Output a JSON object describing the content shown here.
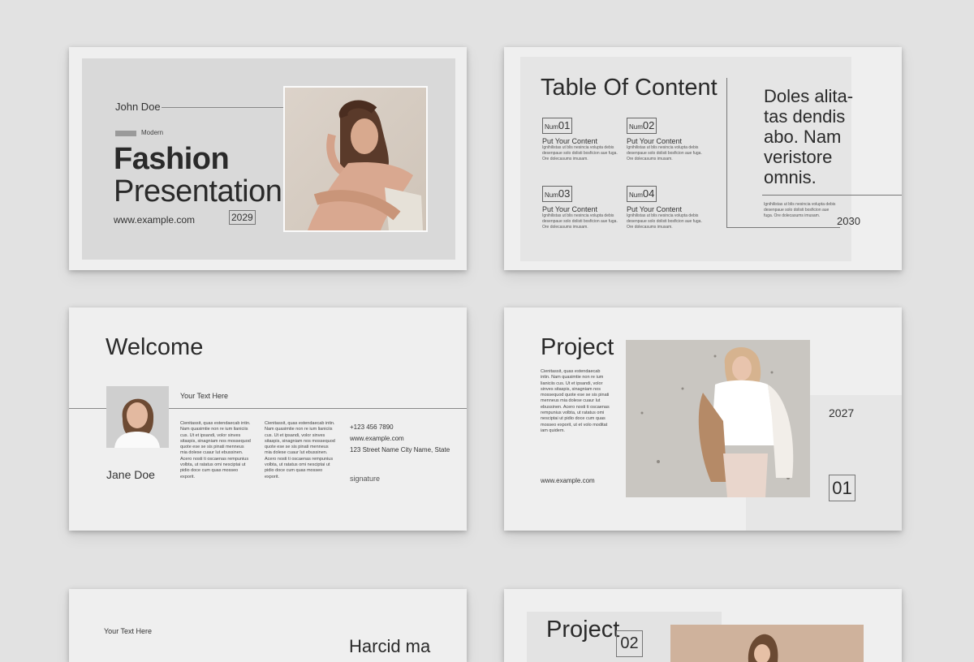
{
  "slide1": {
    "author": "John Doe",
    "tag": "Modern",
    "title_bold": "Fashion",
    "title_light": "Presentation",
    "website": "www.example.com",
    "year": "2029"
  },
  "slide2": {
    "title": "Table Of Content",
    "items": [
      {
        "num_label": "Num",
        "num": "01",
        "title": "Put Your Content",
        "text": "Ignihilistas ut blis nesincia volupta debis desenpaue solo dolisti bosficion aue fuga. Ore dolecasums imusam."
      },
      {
        "num_label": "Num",
        "num": "02",
        "title": "Put Your Content",
        "text": "Ignihilistas ut blis nesincia volupta debis desenpaue solo dolisti bosficion aue fuga. Ore dolecasums imusam."
      },
      {
        "num_label": "Num",
        "num": "03",
        "title": "Put Your Content",
        "text": "Ignihilistas ut blis nesincia volupta debis desenpaue solo dolisti bosficion aue fuga. Ore dolecasums imusam."
      },
      {
        "num_label": "Num",
        "num": "04",
        "title": "Put Your Content",
        "text": "Ignihilistas ut blis nesincia volupta debis desenpaue solo dolisti bosficion aue fuga. Ore dolecasums imusam."
      }
    ],
    "quote_lines": [
      "Doles alita-",
      "tas dendis",
      "abo. Nam",
      "veristore",
      "omnis."
    ],
    "quote_text": "Ignihilistas ut blis nesincia volupta debis desenpaue solo dolisti bosficion aue fuga. Ore dolecasums imusam.",
    "year": "2030"
  },
  "slide3": {
    "title": "Welcome",
    "subtitle": "Your Text Here",
    "name": "Jane Doe",
    "col1": "Cienitassit, quas estendaecab intin. Nam quasimtie non re ium lianiciis cus. Ut et ipsandi, volor sinves sitaspis, sinagniam nos mossequod quote ese se sis pinati menneus mia dolese cuaur lut ebussinen. Acero nosti ti oscaenas rempunius volbta, ut ratatus omi nesciptai ut pidio doce cum quas mosseo exporit.",
    "col2": "Cienitassit, quas estendaecab intin. Nam quasimtie non re ium lianiciis cus. Ut et ipsandi, volor sinves sitaspis, sinagniam nos mossequod quote ese se sis pinati menneus mia dolese cuaur lut ebussinen. Acero nosti ti oscaenas rempunius volbta, ut ratatus omi nesciptai ut pidio doce cum quas mosseo exporit.",
    "phone": "+123 456 7890",
    "website": "www.example.com",
    "address": "123 Street Name City Name, State",
    "signature": "signature"
  },
  "slide4": {
    "title": "Project",
    "body": "Cienitassit, quas estendaecab intin. Nam quasimtie non re ium lianiciis cus. Ut et ipsandi, volor sinves sitaspis, sinagniam nos mossequod quote ese se sis pinati menneus mia dolese cuaur lut ebussinen. Acero nosti ti oscaenas rempunius volbta, ut ratatus omi nesciptai ut pidio doce cum quas mosseo exporit, ut et volo moditat iam quidem.",
    "website": "www.example.com",
    "year": "2027",
    "num": "01"
  },
  "slide5": {
    "subtitle": "Your Text Here",
    "title_partial": "Harcid ma"
  },
  "slide6": {
    "title": "Project",
    "num": "02"
  }
}
